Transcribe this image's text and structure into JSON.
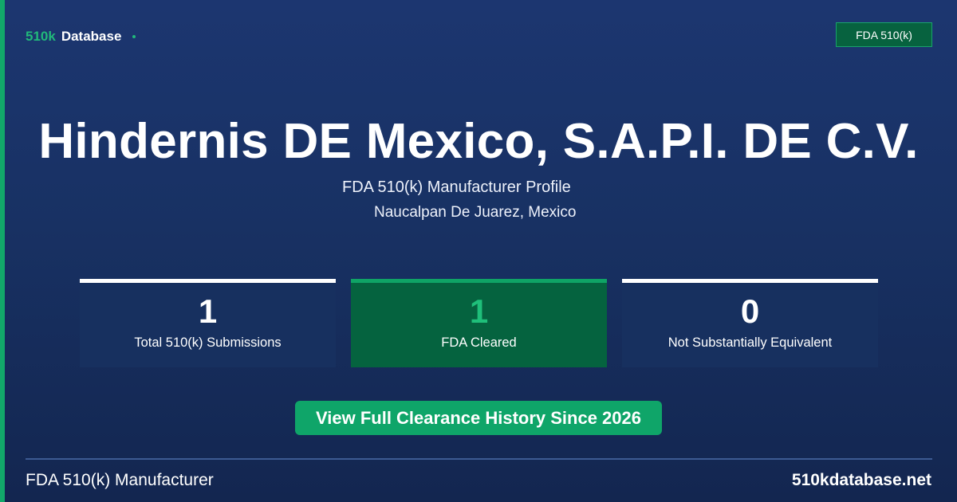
{
  "brand": {
    "accent": "510k",
    "name": "Database"
  },
  "header": {
    "badge": "FDA 510(k)"
  },
  "profile": {
    "title": "Hindernis DE Mexico, S.A.P.I. DE C.V.",
    "subtitle": "FDA 510(k) Manufacturer Profile",
    "location": "Naucalpan De Juarez, Mexico"
  },
  "stats": [
    {
      "value": "1",
      "label": "Total 510(k) Submissions"
    },
    {
      "value": "1",
      "label": "FDA Cleared"
    },
    {
      "value": "0",
      "label": "Not Substantially Equivalent"
    }
  ],
  "cta": {
    "label": "View Full Clearance History Since 2026"
  },
  "footer": {
    "left": "FDA 510(k) Manufacturer",
    "right": "510kdatabase.net"
  },
  "colors": {
    "background": "#1c3670",
    "accent_green": "#12a86a",
    "cleared_panel": "#05633f",
    "cleared_value": "#1fbf7a"
  }
}
